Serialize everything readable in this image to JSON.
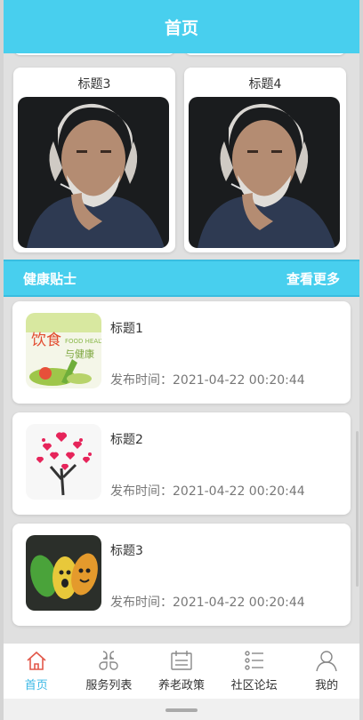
{
  "header": {
    "title": "首页"
  },
  "grid": [
    {
      "title": "标题3"
    },
    {
      "title": "标题4"
    }
  ],
  "section": {
    "title": "健康贴士",
    "more": "查看更多"
  },
  "list": [
    {
      "title": "标题1",
      "time": "发布时间：2021-04-22 00:20:44",
      "thumb_text": "饮食",
      "thumb_text2": "与健康",
      "thumb_en": "FOOD HEALTH"
    },
    {
      "title": "标题2",
      "time": "发布时间：2021-04-22 00:20:44"
    },
    {
      "title": "标题3",
      "time": "发布时间：2021-04-22 00:20:44"
    }
  ],
  "tabs": [
    {
      "label": "首页",
      "icon": "home-icon",
      "active": true
    },
    {
      "label": "服务列表",
      "icon": "grid-icon"
    },
    {
      "label": "养老政策",
      "icon": "calendar-icon"
    },
    {
      "label": "社区论坛",
      "icon": "list-icon"
    },
    {
      "label": "我的",
      "icon": "user-icon"
    }
  ],
  "colors": {
    "accent": "#48cfee",
    "active_tab": "#3bb8e6"
  }
}
